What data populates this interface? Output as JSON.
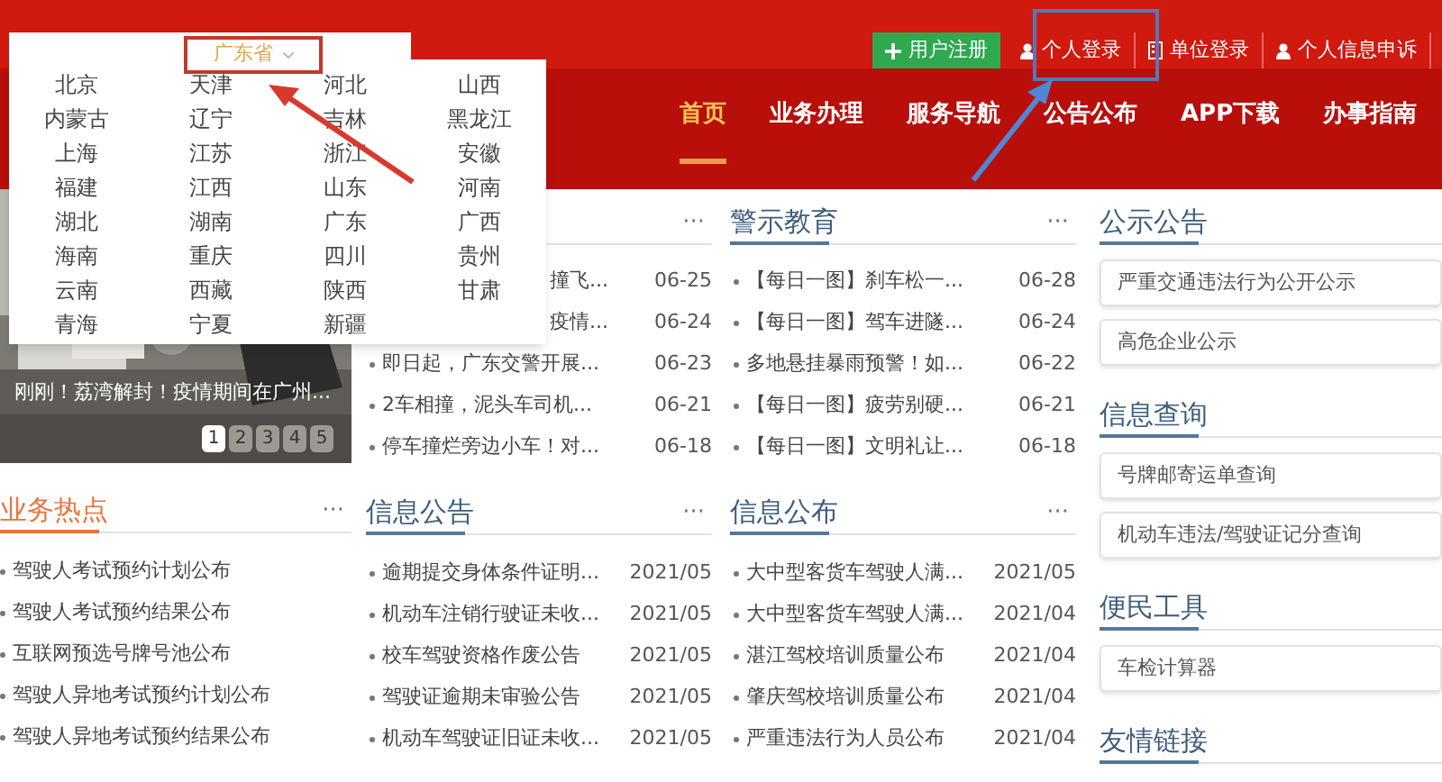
{
  "province_selector": {
    "label": "广东省"
  },
  "province_menu": [
    "北京",
    "天津",
    "河北",
    "山西",
    "内蒙古",
    "辽宁",
    "吉林",
    "黑龙江",
    "上海",
    "江苏",
    "浙江",
    "安徽",
    "福建",
    "江西",
    "山东",
    "河南",
    "湖北",
    "湖南",
    "广东",
    "广西",
    "海南",
    "重庆",
    "四川",
    "贵州",
    "云南",
    "西藏",
    "陕西",
    "甘肃",
    "青海",
    "宁夏",
    "新疆"
  ],
  "account_links": [
    {
      "label": "用户注册",
      "kind": "register"
    },
    {
      "label": "个人登录",
      "kind": "person"
    },
    {
      "label": "单位登录",
      "kind": "org"
    },
    {
      "label": "个人信息申诉",
      "kind": "person"
    }
  ],
  "nav": [
    {
      "label": "首页",
      "selected": true
    },
    {
      "label": "业务办理",
      "selected": false
    },
    {
      "label": "服务导航",
      "selected": false
    },
    {
      "label": "公告公布",
      "selected": false
    },
    {
      "label": "APP下载",
      "selected": false
    },
    {
      "label": "办事指南",
      "selected": false
    }
  ],
  "carousel": {
    "caption": "刚刚！荔湾解封！疫情期间在广州...",
    "pages": [
      {
        "label": "1",
        "selected": true
      },
      {
        "label": "2",
        "selected": false
      },
      {
        "label": "3",
        "selected": false
      },
      {
        "label": "4",
        "selected": false
      },
      {
        "label": "5",
        "selected": false
      }
    ]
  },
  "news_panel": {
    "more": "···",
    "items": [
      {
        "title": "撞飞...",
        "date": "06-25",
        "kind": "cut"
      },
      {
        "title": "疫情...",
        "date": "06-24",
        "kind": "cut"
      },
      {
        "title": "即日起，广东交警开展...",
        "date": "06-23",
        "kind": "full"
      },
      {
        "title": "2车相撞，泥头车司机...",
        "date": "06-21",
        "kind": "full"
      },
      {
        "title": "停车撞烂旁边小车！对...",
        "date": "06-18",
        "kind": "full"
      }
    ]
  },
  "warning_education": {
    "title": "警示教育",
    "more": "···",
    "items": [
      {
        "title": "【每日一图】刹车松一...",
        "date": "06-28",
        "kind": "full"
      },
      {
        "title": "【每日一图】驾车进隧...",
        "date": "06-24",
        "kind": "full"
      },
      {
        "title": "多地悬挂暴雨预警！如...",
        "date": "06-22",
        "kind": "full"
      },
      {
        "title": "【每日一图】疲劳别硬...",
        "date": "06-21",
        "kind": "full"
      },
      {
        "title": "【每日一图】文明礼让...",
        "date": "06-18",
        "kind": "full"
      }
    ]
  },
  "business_hotspots": {
    "title": "业务热点",
    "more": "···",
    "items": [
      {
        "title": "驾驶人考试预约计划公布"
      },
      {
        "title": "驾驶人考试预约结果公布"
      },
      {
        "title": "互联网预选号牌号池公布"
      },
      {
        "title": "驾驶人异地考试预约计划公布"
      },
      {
        "title": "驾驶人异地考试预约结果公布"
      }
    ]
  },
  "info_notices": {
    "title": "信息公告",
    "more": "···",
    "items": [
      {
        "title": "逾期提交身体条件证明...",
        "date": "2021/05",
        "kind": "full"
      },
      {
        "title": "机动车注销行驶证未收...",
        "date": "2021/05",
        "kind": "full"
      },
      {
        "title": "校车驾驶资格作废公告",
        "date": "2021/05",
        "kind": "full"
      },
      {
        "title": "驾驶证逾期未审验公告",
        "date": "2021/05",
        "kind": "full"
      },
      {
        "title": "机动车驾驶证旧证未收...",
        "date": "2021/05",
        "kind": "full"
      }
    ]
  },
  "info_publications": {
    "title": "信息公布",
    "more": "···",
    "items": [
      {
        "title": "大中型客货车驾驶人满...",
        "date": "2021/05",
        "kind": "full"
      },
      {
        "title": "大中型客货车驾驶人满...",
        "date": "2021/04",
        "kind": "full"
      },
      {
        "title": "湛江驾校培训质量公布",
        "date": "2021/04",
        "kind": "full"
      },
      {
        "title": "肇庆驾校培训质量公布",
        "date": "2021/04",
        "kind": "full"
      },
      {
        "title": "严重违法行为人员公布",
        "date": "2021/04",
        "kind": "full"
      }
    ]
  },
  "sidebar": [
    {
      "title": "公示公告",
      "links": [
        "严重交通违法行为公开公示",
        "高危企业公示"
      ]
    },
    {
      "title": "信息查询",
      "links": [
        "号牌邮寄运单查询",
        "机动车违法/驾驶证记分查询"
      ]
    },
    {
      "title": "便民工具",
      "links": [
        "车检计算器"
      ]
    },
    {
      "title": "友情链接"
    }
  ]
}
